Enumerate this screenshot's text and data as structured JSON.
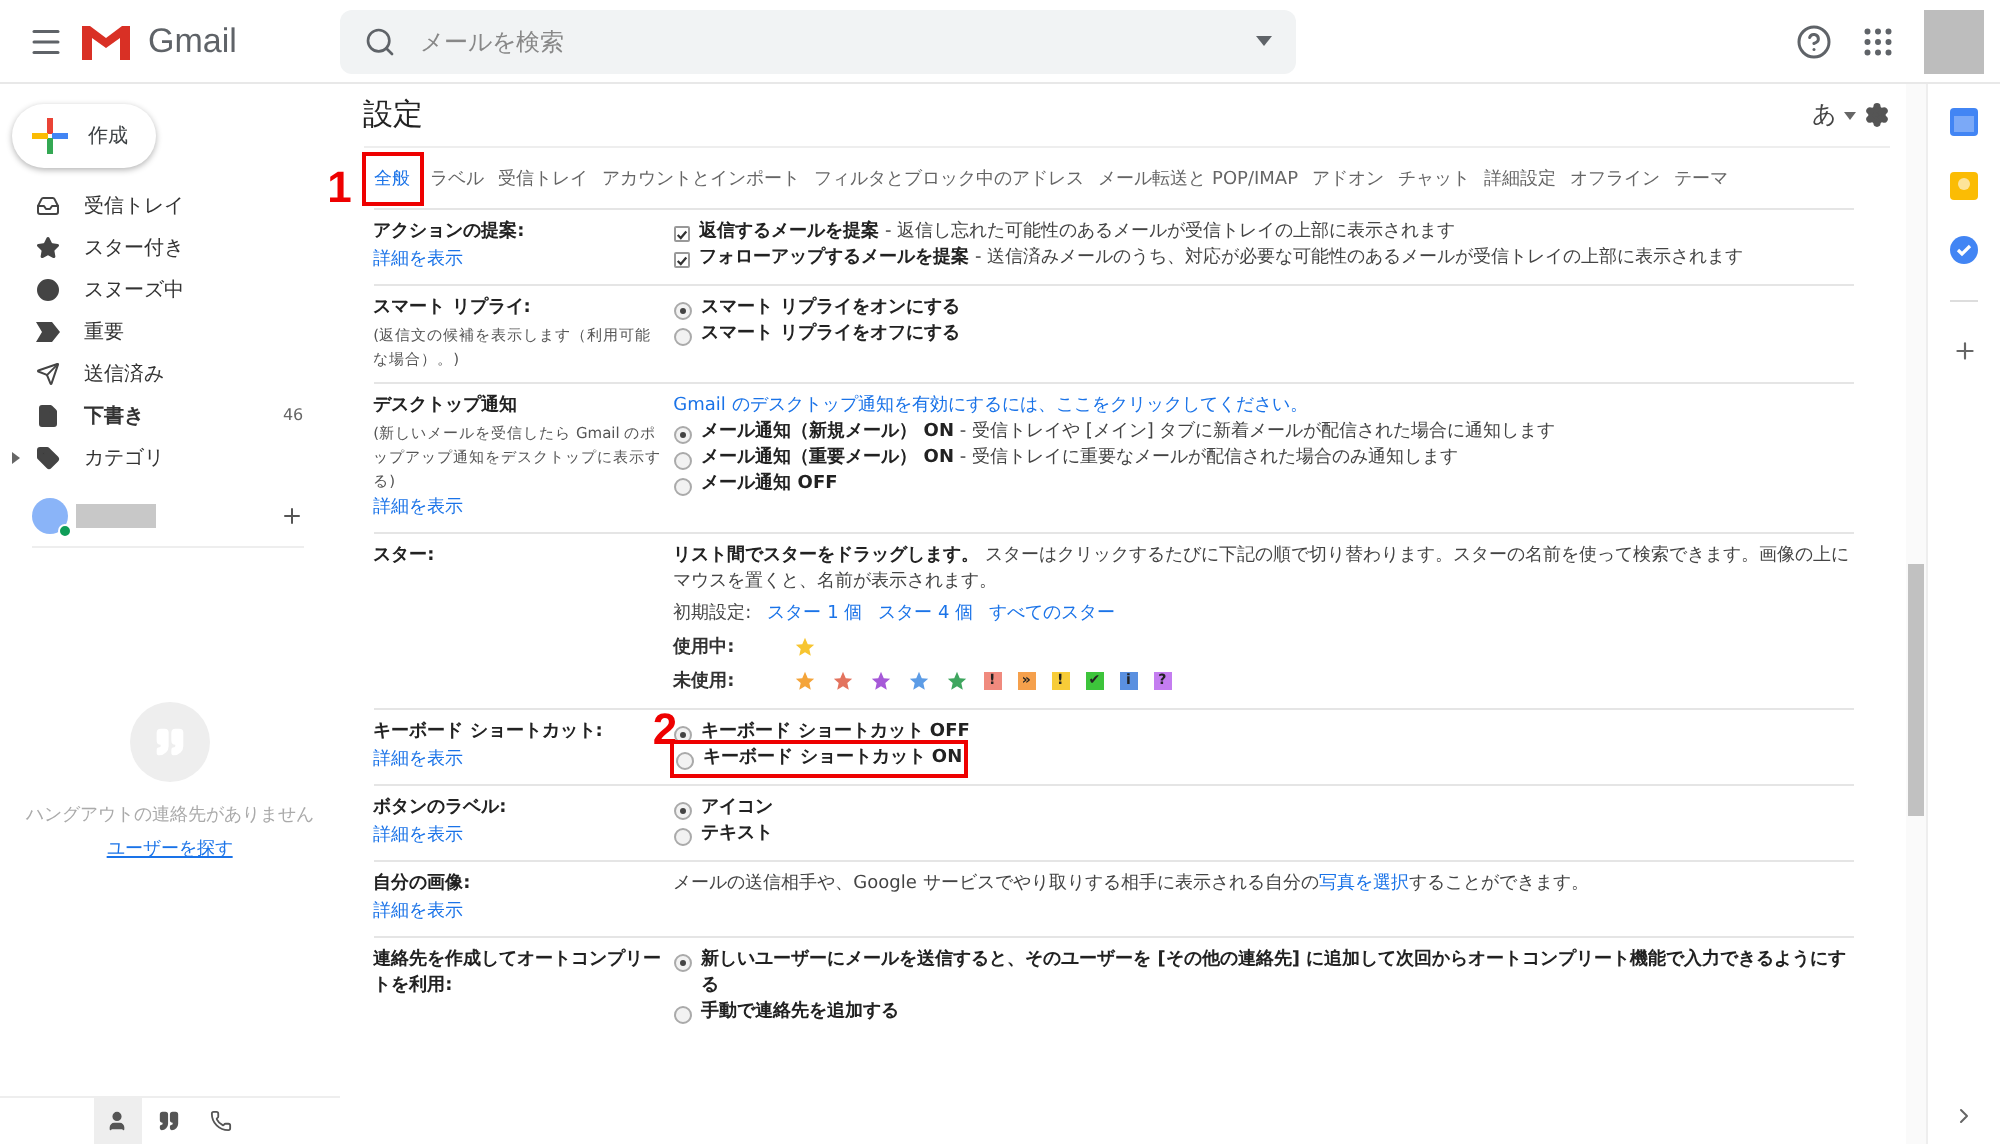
{
  "header": {
    "app_name": "Gmail",
    "search": {
      "placeholder": "メールを検索"
    }
  },
  "sidebar": {
    "compose": "作成",
    "items": [
      {
        "label": "受信トレイ",
        "selected": false
      },
      {
        "label": "スター付き",
        "selected": false
      },
      {
        "label": "スヌーズ中",
        "selected": false
      },
      {
        "label": "重要",
        "selected": false
      },
      {
        "label": "送信済み",
        "selected": false
      },
      {
        "label": "下書き",
        "count": "46",
        "selected": false
      },
      {
        "label": "カテゴリ",
        "expanded": false,
        "selected": false
      }
    ],
    "account": {
      "online": true
    },
    "hangouts": {
      "empty_text": "ハングアウトの連絡先がありません",
      "link": "ユーザーを探す"
    },
    "bottom_tabs": [
      {
        "selected": true
      },
      {
        "selected": false
      },
      {
        "selected": false
      }
    ]
  },
  "settings": {
    "title": "設定",
    "input_tool": "あ",
    "tabs": [
      {
        "label": "全般",
        "selected": true,
        "annotation": "1"
      },
      {
        "label": "ラベル",
        "selected": false
      },
      {
        "label": "受信トレイ",
        "selected": false
      },
      {
        "label": "アカウントとインポート",
        "selected": false
      },
      {
        "label": "フィルタとブロック中のアドレス",
        "selected": false
      },
      {
        "label": "メール転送と POP/IMAP",
        "selected": false
      },
      {
        "label": "アドオン",
        "selected": false
      },
      {
        "label": "チャット",
        "selected": false
      },
      {
        "label": "詳細設定",
        "selected": false
      },
      {
        "label": "オフライン",
        "selected": false
      },
      {
        "label": "テーマ",
        "selected": false
      }
    ],
    "rows": [
      {
        "label": "アクションの提案:",
        "link": "詳細を表示",
        "options": [
          {
            "kind": "checkbox",
            "checked": true,
            "text": "**返信するメールを提案** - 返信し忘れた可能性のあるメールが受信トレイの上部に表示されます"
          },
          {
            "kind": "checkbox",
            "checked": true,
            "text": "**フォローアップするメールを提案** - 送信済みメールのうち、対応が必要な可能性のあるメールが受信トレイの上部に表示されます"
          }
        ]
      },
      {
        "label": "スマート リプライ:",
        "note": "(返信文の候補を表示します（利用可能な場合）。)",
        "options": [
          {
            "kind": "radio",
            "selected": true,
            "text": "**スマート リプライをオンにする**"
          },
          {
            "kind": "radio",
            "selected": false,
            "text": "**スマート リプライをオフにする**"
          }
        ]
      },
      {
        "label": "デスクトップ通知",
        "note": "(新しいメールを受信したら Gmail のポップアップ通知をデスクトップに表示する)",
        "link": "詳細を表示",
        "options": [
          {
            "kind": "link",
            "text": "Gmail のデスクトップ通知を有効にするには、ここをクリックしてください。"
          },
          {
            "kind": "radio",
            "selected": true,
            "text": "**メール通知（新規メール） ON** - 受信トレイや [メイン] タブに新着メールが配信された場合に通知します"
          },
          {
            "kind": "radio",
            "selected": false,
            "text": "**メール通知（重要メール） ON** - 受信トレイに重要なメールが配信された場合のみ通知します"
          },
          {
            "kind": "radio",
            "selected": false,
            "text": "**メール通知 OFF**"
          }
        ]
      },
      {
        "label": "スター:",
        "options": [
          {
            "kind": "text",
            "text": "**リスト間でスターをドラッグします。** スターはクリックするたびに下記の順で切り替わります。スターの名前を使って検索できます。画像の上にマウスを置くと、名前が表示されます。"
          },
          {
            "kind": "presets",
            "label": "初期設定:",
            "links": [
              "スター 1 個",
              "スター 4 個",
              "すべてのスター"
            ]
          },
          {
            "kind": "stars",
            "label": "使用中:",
            "items": [
              {
                "kind": "star",
                "color": "#f7c531"
              }
            ]
          },
          {
            "kind": "stars",
            "label": "未使用:",
            "items": [
              {
                "kind": "star",
                "color": "#f4a43a"
              },
              {
                "kind": "star",
                "color": "#e3735e"
              },
              {
                "kind": "star",
                "color": "#a659d8"
              },
              {
                "kind": "star",
                "color": "#5c9ce6"
              },
              {
                "kind": "star",
                "color": "#3fa65f"
              },
              {
                "kind": "badge",
                "color": "#f08a7e",
                "glyph": "!"
              },
              {
                "kind": "badge",
                "color": "#f5a04c",
                "glyph": "»"
              },
              {
                "kind": "badge",
                "color": "#f7cc38",
                "glyph": "!"
              },
              {
                "kind": "badge",
                "color": "#3dc43b",
                "glyph": "✔"
              },
              {
                "kind": "badge",
                "color": "#5a90e0",
                "glyph": "i"
              },
              {
                "kind": "badge",
                "color": "#c47df0",
                "glyph": "?"
              }
            ]
          }
        ]
      },
      {
        "label": "キーボード ショートカット:",
        "link": "詳細を表示",
        "annotation": "2",
        "options": [
          {
            "kind": "radio",
            "selected": true,
            "text": "**キーボード ショートカット OFF**"
          },
          {
            "kind": "radio",
            "selected": false,
            "highlighted": true,
            "text": "**キーボード ショートカット ON**"
          }
        ]
      },
      {
        "label": "ボタンのラベル:",
        "link": "詳細を表示",
        "options": [
          {
            "kind": "radio",
            "selected": true,
            "text": "**アイコン**"
          },
          {
            "kind": "radio",
            "selected": false,
            "text": "**テキスト**"
          }
        ]
      },
      {
        "label": "自分の画像:",
        "link": "詳細を表示",
        "options": [
          {
            "kind": "linked_text",
            "before": "メールの送信相手や、Google サービスでやり取りする相手に表示される自分の",
            "link": "写真を選択",
            "after": "することができます。"
          }
        ]
      },
      {
        "label": "連絡先を作成してオートコンプリートを利用:",
        "options": [
          {
            "kind": "radio",
            "selected": true,
            "text": "**新しいユーザーにメールを送信すると、そのユーザーを [その他の連絡先] に追加して次回からオートコンプリート機能で入力できるようにする**"
          },
          {
            "kind": "radio",
            "selected": false,
            "text": "**手動で連絡先を追加する**"
          }
        ]
      }
    ]
  }
}
